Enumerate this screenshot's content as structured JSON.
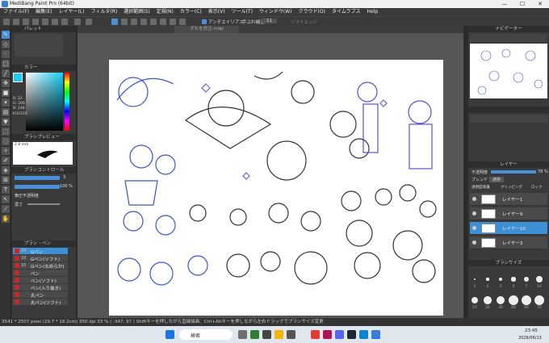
{
  "window": {
    "title": "MediBang Paint Pro (64bit)",
    "minimize": "—",
    "maximize": "☐",
    "close": "✕"
  },
  "menu": [
    "ファイル(F)",
    "編集(E)",
    "レイヤー(L)",
    "フィルタ(R)",
    "選択範囲(S)",
    "定規(N)",
    "カラー(C)",
    "表示(V)",
    "ツール(T)",
    "ウィンドウ(W)",
    "クラウド(O)",
    "タイムラプス",
    "Help"
  ],
  "toolbar": {
    "antialias": "アンチエイリアス",
    "stroke_label": "手ぶれ補正",
    "stroke_value": "11",
    "soft_edge": "ソフトエッジ"
  },
  "document_tab": "ずれを修正.mdp",
  "panels": {
    "palette": "パレット",
    "color": "カラー",
    "brush_preview": "ブラシプレビュー",
    "brush_control": "ブラシコントロール",
    "brush_list": "ブラシ・ペン",
    "navigator": "ナビゲーター",
    "layers": "レイヤー",
    "brush_size": "ブラシサイズ"
  },
  "color_panel": {
    "hex": "#16CEF8",
    "r": "R: 22",
    "g": "G: 206",
    "b": "B: 248",
    "fg_color": "#16cef8"
  },
  "brush_preview_size": "2.8 mm",
  "brush_control": {
    "size_value": "3",
    "opacity_value": "100 %",
    "pressure_label": "筆圧不透明度",
    "density_label": "濃さ"
  },
  "brushes": [
    {
      "size": "10",
      "name": "Gペン",
      "selected": true
    },
    {
      "size": "10",
      "name": "Gペン(ソフト)",
      "selected": false
    },
    {
      "size": "10",
      "name": "Gペン(なめらか)",
      "selected": false
    },
    {
      "size": "",
      "name": "ペン",
      "selected": false
    },
    {
      "size": "",
      "name": "ペン(ソフト)",
      "selected": false
    },
    {
      "size": "",
      "name": "ペン(入り抜き)",
      "selected": false
    },
    {
      "size": "",
      "name": "丸ペン",
      "selected": false
    },
    {
      "size": "",
      "name": "丸ペン(ソフト)",
      "selected": false
    }
  ],
  "layers_panel": {
    "opacity_label": "不透明度",
    "opacity_value": "78 %",
    "blend_label": "ブレンド",
    "blend_value": "通常",
    "protect_label": "透明度保護",
    "clipping_label": "クリッピング",
    "lock_label": "ロック",
    "items": [
      {
        "name": "レイヤー1",
        "selected": false
      },
      {
        "name": "レイヤー9",
        "selected": false
      },
      {
        "name": "レイヤー10",
        "selected": true
      },
      {
        "name": "レイヤー3",
        "selected": false
      }
    ]
  },
  "brush_sizes": [
    "1",
    "2",
    "3",
    "5",
    "7",
    "10",
    "15",
    "20",
    "30",
    "40",
    "50",
    "70"
  ],
  "status": "3541 * 2507 pixel  (29.7 * 18.2cm)  350 dpi  33 %  ( -347, 97 )  Shiftキーを押しながら直線描画、Ctrl+Altキーを押しながら左右ドラッグでブラシサイズ変更",
  "taskbar": {
    "search": "検索",
    "time": "23:45",
    "date": "2026/06/13"
  }
}
